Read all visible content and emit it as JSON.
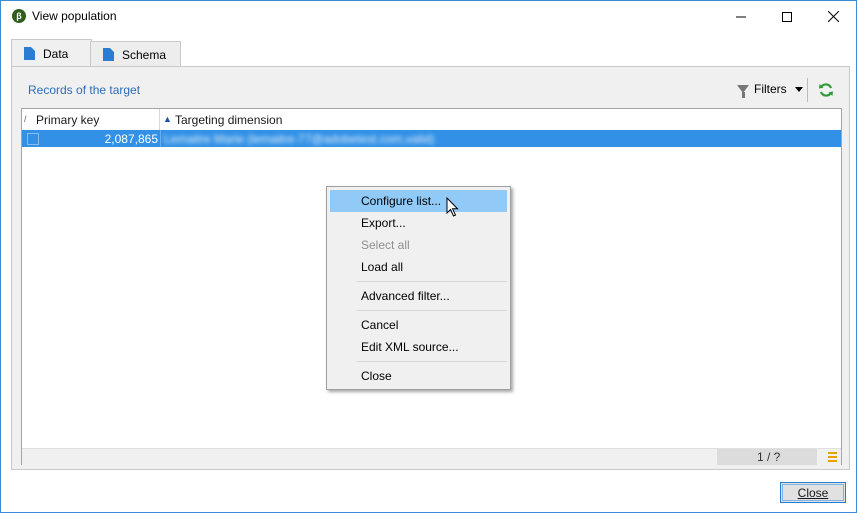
{
  "window": {
    "title": "View population",
    "app_icon_glyph": "β",
    "accent_color": "#3c8bd6"
  },
  "tabs": [
    {
      "label": "Data",
      "icon": "sql-file-icon",
      "active": true
    },
    {
      "label": "Schema",
      "icon": "xml-file-icon",
      "active": false
    }
  ],
  "section": {
    "title": "Records of the target",
    "filters_label": "Filters"
  },
  "grid": {
    "columns": [
      {
        "label": "Primary key",
        "sort_mark": "/"
      },
      {
        "label": "Targeting dimension",
        "sort_mark": "▲"
      }
    ],
    "rows": [
      {
        "primary_key": "2,087,865",
        "targeting_dimension": "Lemaitre Marie (lemaitre-77@adobetest.com,valid)",
        "selected": true
      }
    ],
    "pager": "1 / ?"
  },
  "context_menu": {
    "items": [
      {
        "label": "Configure list...",
        "state": "highlighted"
      },
      {
        "label": "Export...",
        "state": "normal"
      },
      {
        "label": "Select all",
        "state": "disabled"
      },
      {
        "label": "Load all",
        "state": "normal"
      },
      {
        "label": "Advanced filter...",
        "state": "normal"
      },
      {
        "label": "Cancel",
        "state": "normal"
      },
      {
        "label": "Edit XML source...",
        "state": "normal"
      },
      {
        "label": "Close",
        "state": "normal"
      }
    ]
  },
  "footer": {
    "close_label": "Close"
  },
  "colors": {
    "selection": "#3291e6",
    "menu_highlight": "#91c9f7",
    "link_blue": "#2e6bb5",
    "refresh_green": "#2e9a3a"
  }
}
